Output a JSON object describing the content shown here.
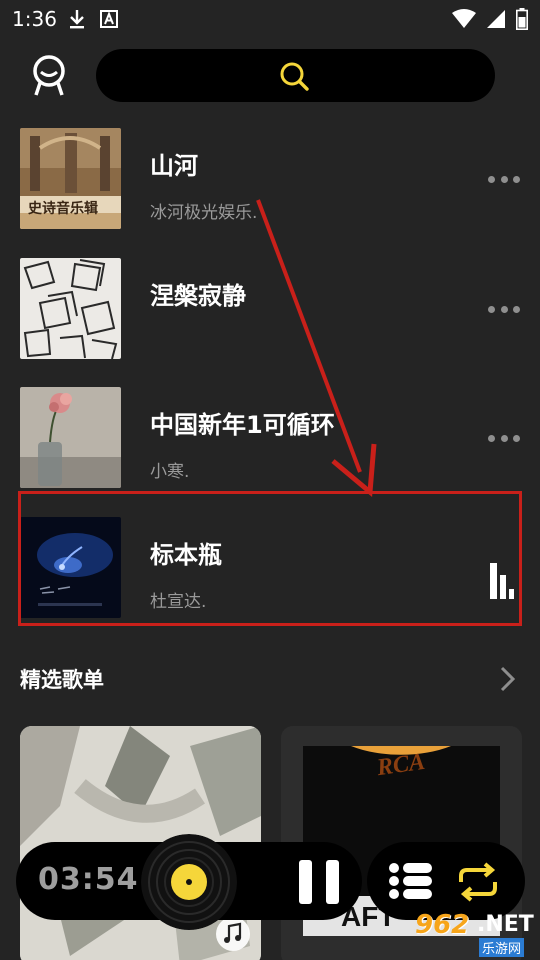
{
  "status_bar": {
    "time": "1:36",
    "icons": [
      "download-icon",
      "font-a-icon",
      "wifi-icon",
      "signal-icon",
      "battery-icon"
    ]
  },
  "header": {
    "avatar_icon": "face-avatar-icon",
    "search_icon": "search-icon",
    "accent_color": "#f5d63a"
  },
  "songs": [
    {
      "title": "山河",
      "artist": "冰河极光娱乐.",
      "cover_text": "史诗音乐辑"
    },
    {
      "title": "涅槃寂静",
      "artist": ""
    },
    {
      "title": "中国新年1可循环",
      "artist": "小寒."
    },
    {
      "title": "标本瓶",
      "artist": "杜宣达.",
      "playing": true
    }
  ],
  "playlists_section": {
    "title": "精选歌单"
  },
  "playlists": [
    {
      "name": ""
    },
    {
      "name": "",
      "record_label": "RCA"
    }
  ],
  "player": {
    "time": "03:54",
    "state": "playing",
    "vinyl_color": "#f5d63a",
    "controls_accent": "#f5d63a"
  },
  "annotation": {
    "color": "#c9201a"
  },
  "watermark": {
    "number": "962",
    "net": ".NET",
    "site": "乐游网"
  }
}
